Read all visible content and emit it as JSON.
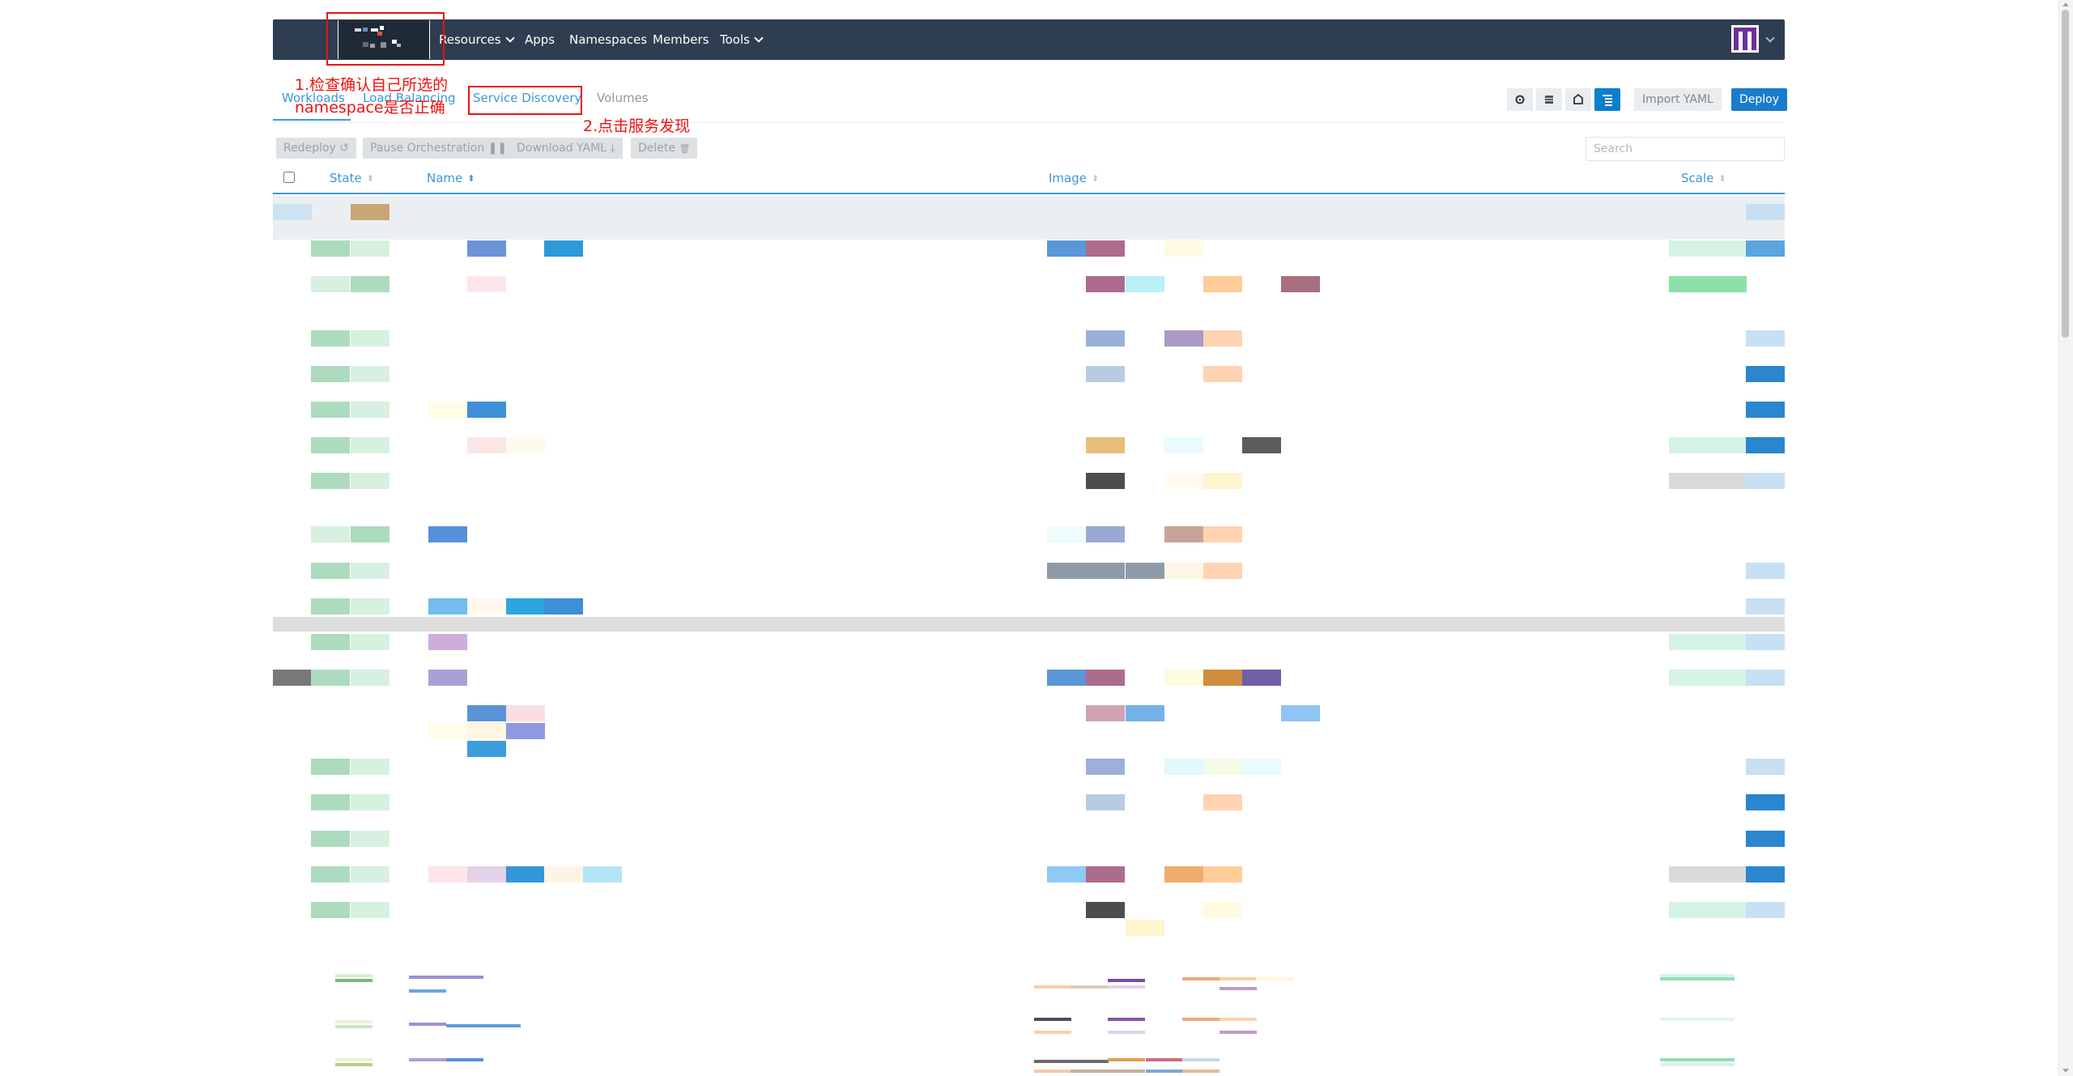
{
  "header": {
    "nav": [
      {
        "label": "Resources",
        "has_caret": true
      },
      {
        "label": "Apps",
        "has_caret": false
      },
      {
        "label": "Namespaces",
        "has_caret": false
      },
      {
        "label": "Members",
        "has_caret": false
      },
      {
        "label": "Tools",
        "has_caret": true
      }
    ],
    "colors": {
      "bar": "#2e3d4f",
      "accent": "#3d98d3",
      "primary": "#1a7ccc"
    }
  },
  "tabs": [
    {
      "label": "Workloads",
      "active": true
    },
    {
      "label": "Load Balancing",
      "active": false
    },
    {
      "label": "Service Discovery",
      "active": false
    },
    {
      "label": "Volumes",
      "active": false
    }
  ],
  "view_toggles": [
    "gear-icon",
    "list-icon",
    "node-icon",
    "tree-list-icon"
  ],
  "buttons": {
    "import_yaml": "Import YAML",
    "deploy": "Deploy"
  },
  "bulk_actions": [
    {
      "label": "Redeploy",
      "icon": "↺"
    },
    {
      "label": "Pause Orchestration",
      "icon": "❚❚"
    },
    {
      "label": "Download YAML",
      "icon": "⤓"
    },
    {
      "label": "Delete",
      "icon": "🗑"
    }
  ],
  "search": {
    "placeholder": "Search",
    "value": ""
  },
  "table": {
    "headers": [
      "State",
      "Name",
      "Image",
      "Scale"
    ],
    "sorted_by": "Name"
  },
  "annotations": {
    "note1_line1": "1.检查确认自己所选的",
    "note1_line2": "namespace是否正确",
    "note2": "2.点击服务发现"
  }
}
